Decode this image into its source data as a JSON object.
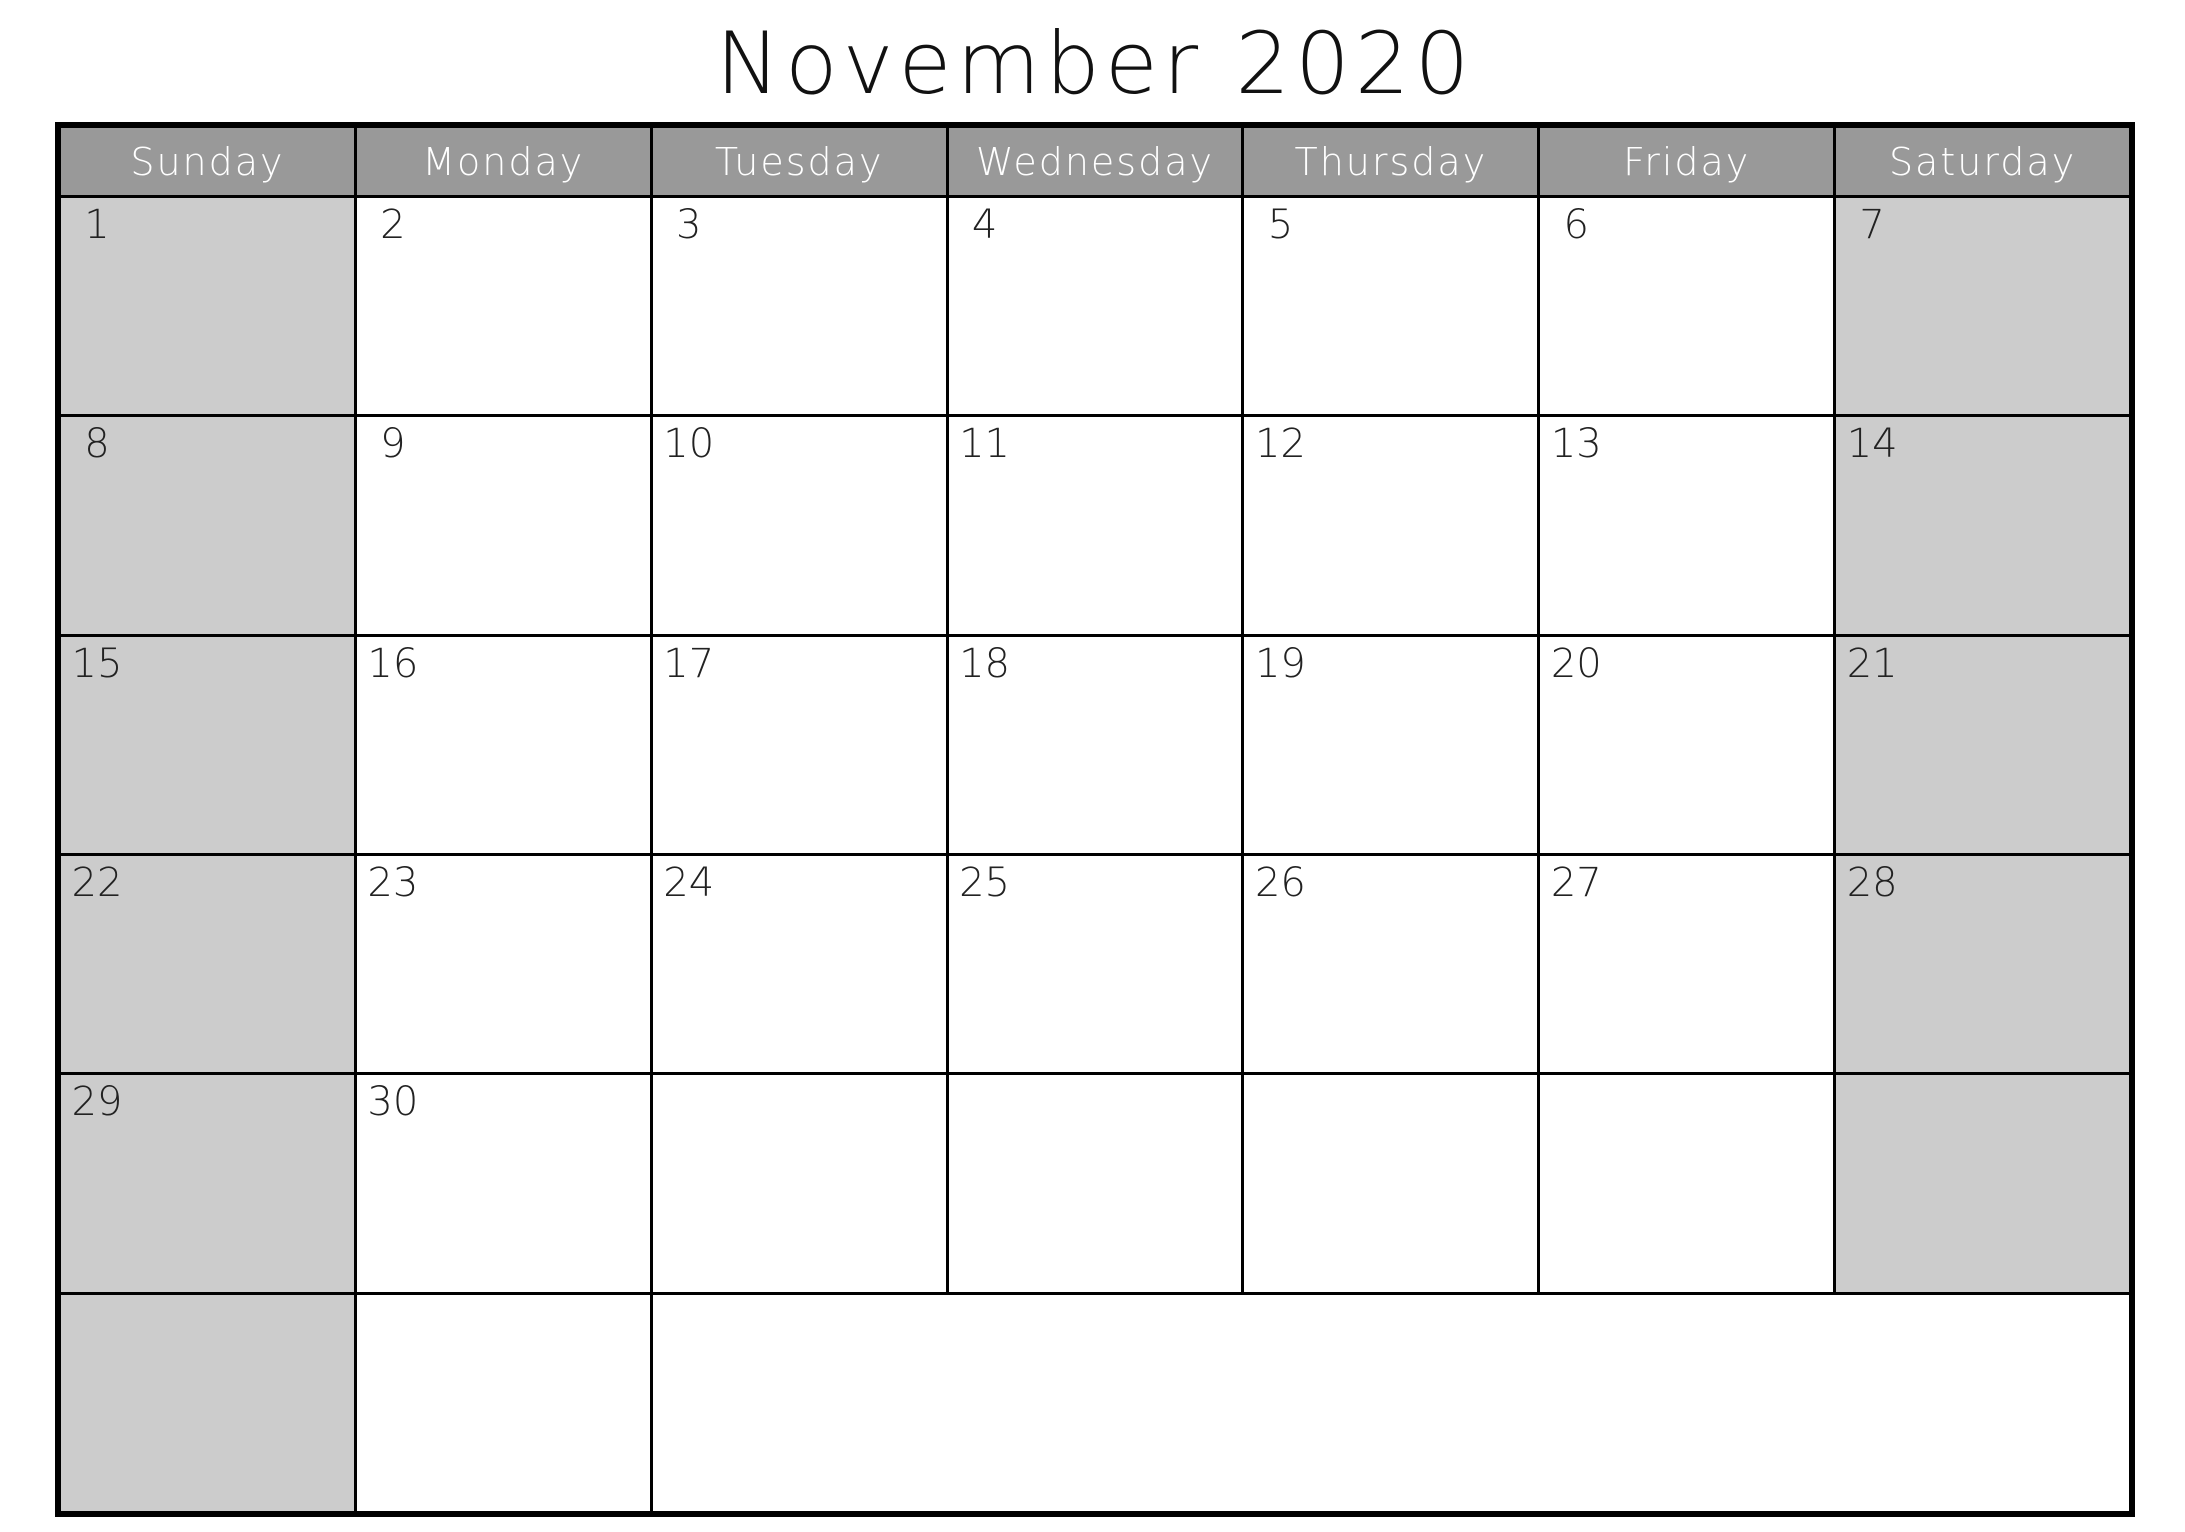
{
  "calendar": {
    "title": "November 2020",
    "colors": {
      "header_bg": "#999999",
      "header_text": "#ffffff",
      "weekend_bg": "#cccccc",
      "weekday_bg": "#ffffff",
      "grid_lines": "#000000"
    },
    "weekdays": [
      "Sunday",
      "Monday",
      "Tuesday",
      "Wednesday",
      "Thursday",
      "Friday",
      "Saturday"
    ],
    "weeks": [
      [
        "1",
        "2",
        "3",
        "4",
        "5",
        "6",
        "7"
      ],
      [
        "8",
        "9",
        "10",
        "11",
        "12",
        "13",
        "14"
      ],
      [
        "15",
        "16",
        "17",
        "18",
        "19",
        "20",
        "21"
      ],
      [
        "22",
        "23",
        "24",
        "25",
        "26",
        "27",
        "28"
      ],
      [
        "29",
        "30",
        "",
        "",
        "",
        "",
        ""
      ],
      [
        "",
        ""
      ]
    ]
  }
}
